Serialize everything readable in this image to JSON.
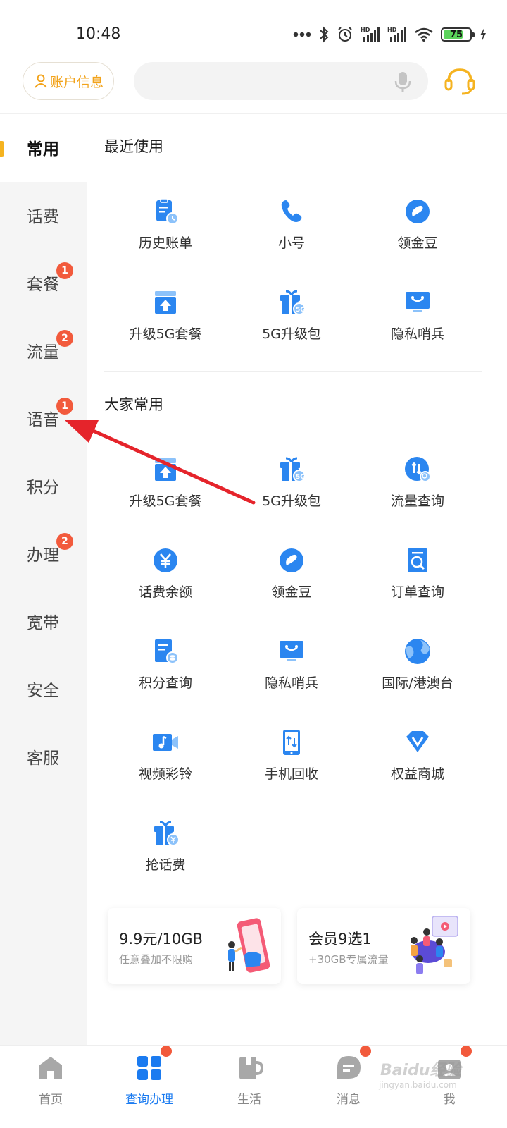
{
  "status_bar": {
    "time": "10:48",
    "battery": "75",
    "battery_level": 0.75,
    "icons": [
      "more-dots-icon",
      "bluetooth-icon",
      "alarm-icon",
      "hd-signal-icon",
      "hd-signal-icon",
      "wifi-icon",
      "battery-icon",
      "charging-icon"
    ]
  },
  "header": {
    "account_label": "账户信息",
    "search_placeholder": "",
    "accent_color": "#f2a31b"
  },
  "sidebar": {
    "items": [
      {
        "label": "常用",
        "badge": ""
      },
      {
        "label": "话费",
        "badge": ""
      },
      {
        "label": "套餐",
        "badge": "1"
      },
      {
        "label": "流量",
        "badge": "2"
      },
      {
        "label": "语音",
        "badge": "1"
      },
      {
        "label": "积分",
        "badge": ""
      },
      {
        "label": "办理",
        "badge": "2"
      },
      {
        "label": "宽带",
        "badge": ""
      },
      {
        "label": "安全",
        "badge": ""
      },
      {
        "label": "客服",
        "badge": ""
      }
    ]
  },
  "recent": {
    "title": "最近使用",
    "items": [
      {
        "label": "历史账单",
        "icon": "bill-history-icon"
      },
      {
        "label": "小号",
        "icon": "phone-icon"
      },
      {
        "label": "领金豆",
        "icon": "bean-icon"
      },
      {
        "label": "升级5G套餐",
        "icon": "upgrade-icon"
      },
      {
        "label": "5G升级包",
        "icon": "gift-5g-icon"
      },
      {
        "label": "隐私哨兵",
        "icon": "privacy-monitor-icon"
      }
    ]
  },
  "popular": {
    "title": "大家常用",
    "items": [
      {
        "label": "升级5G套餐",
        "icon": "upgrade-icon"
      },
      {
        "label": "5G升级包",
        "icon": "gift-5g-icon"
      },
      {
        "label": "流量查询",
        "icon": "data-query-icon"
      },
      {
        "label": "话费余额",
        "icon": "yuan-icon"
      },
      {
        "label": "领金豆",
        "icon": "bean-icon"
      },
      {
        "label": "订单查询",
        "icon": "order-search-icon"
      },
      {
        "label": "积分查询",
        "icon": "points-icon"
      },
      {
        "label": "隐私哨兵",
        "icon": "privacy-monitor-icon"
      },
      {
        "label": "国际/港澳台",
        "icon": "globe-icon"
      },
      {
        "label": "视频彩铃",
        "icon": "video-ringtone-icon"
      },
      {
        "label": "手机回收",
        "icon": "phone-recycle-icon"
      },
      {
        "label": "权益商城",
        "icon": "vip-mall-icon"
      },
      {
        "label": "抢话费",
        "icon": "gift-yuan-icon"
      }
    ]
  },
  "promos": [
    {
      "title": "9.9元/10GB",
      "subtitle": "任意叠加不限购"
    },
    {
      "title": "会员9选1",
      "subtitle": "+30GB专属流量"
    }
  ],
  "bottom_nav": {
    "items": [
      {
        "label": "首页",
        "icon": "home-icon",
        "dot": false
      },
      {
        "label": "查询办理",
        "icon": "grid-icon",
        "dot": true
      },
      {
        "label": "生活",
        "icon": "cup-icon",
        "dot": false
      },
      {
        "label": "消息",
        "icon": "message-icon",
        "dot": true
      },
      {
        "label": "我",
        "icon": "profile-icon",
        "dot": true
      }
    ]
  },
  "watermark": {
    "text": "Baidu经验",
    "sub": "jingyan.baidu.com"
  },
  "colors": {
    "brand_blue": "#1b7bf0",
    "badge_red": "#f25a3c",
    "accent_yellow": "#f5b320",
    "arrow_red": "#e5242b"
  }
}
